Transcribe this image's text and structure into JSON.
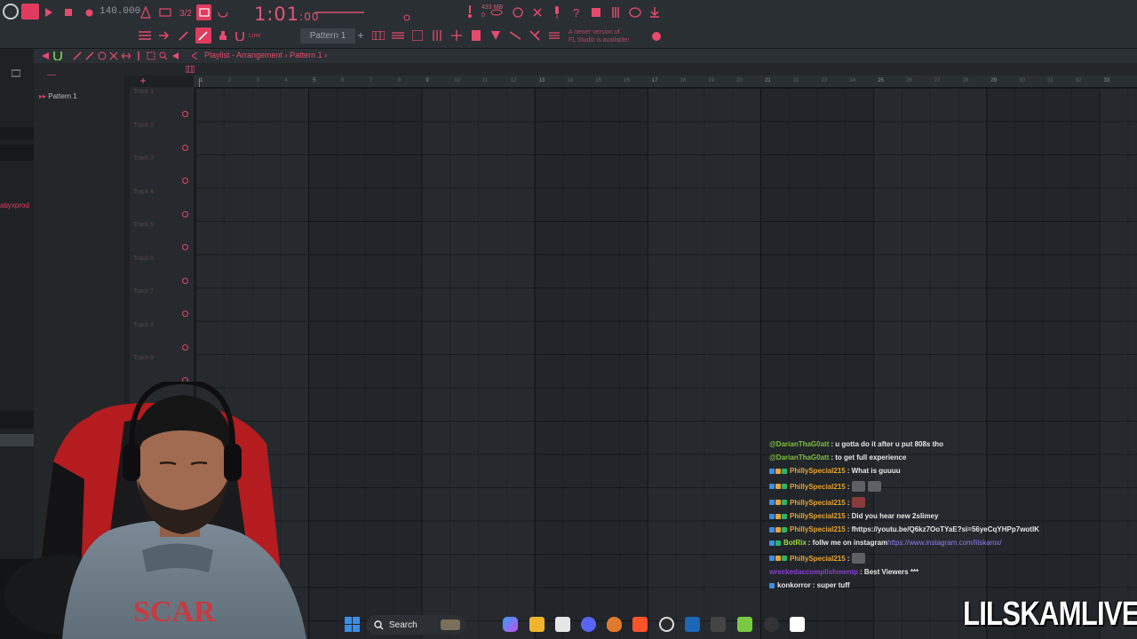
{
  "toolbar": {
    "bpm": "140.000",
    "song_time": "1:01",
    "song_time_ticks": ":00",
    "memory": "433 MB",
    "memory_sub": "0",
    "pattern": "Pattern 1",
    "snap": "Line",
    "update_notice_line1": "A newer version of",
    "update_notice_line2": "FL Studio is available!"
  },
  "playlist": {
    "title": "Playlist - Arrangement",
    "separator": "›",
    "pattern_crumb": "Pattern 1",
    "picker_item": "Pattern 1",
    "tracks": [
      "Track 1",
      "Track 2",
      "Track 3",
      "Track 4",
      "Track 5",
      "Track 6",
      "Track 7",
      "Track 8",
      "Track 9"
    ],
    "bar_numbers": [
      "1",
      "2",
      "3",
      "4",
      "5",
      "6",
      "7",
      "8",
      "9",
      "10",
      "11",
      "12",
      "13",
      "14",
      "15",
      "16",
      "17",
      "18",
      "19",
      "20",
      "21",
      "22",
      "23",
      "24",
      "25",
      "26",
      "27",
      "28",
      "29",
      "30",
      "31",
      "32",
      "33"
    ]
  },
  "browser": {
    "user_label": "abyxprod"
  },
  "chat": {
    "messages": [
      {
        "user": "@DarianThaG0att",
        "text": ": u gotta do it after u put 808s tho",
        "color": "#7fbf3a"
      },
      {
        "user": "@DarianThaG0att",
        "text": ": to get full experience",
        "color": "#7fbf3a"
      },
      {
        "user": "PhillySpecial215",
        "text": ": What is guuuu",
        "color": "#e6a536"
      },
      {
        "user": "PhillySpecial215",
        "text": ":",
        "color": "#e6a536"
      },
      {
        "user": "PhillySpecial215",
        "text": ":",
        "color": "#e6a536"
      },
      {
        "user": "PhillySpecial215",
        "text": ": Did you hear new 2slimey",
        "color": "#e6a536"
      },
      {
        "user": "PhillySpecial215",
        "text": ": fhttps://youtu.be/Q6kz7OoTYaE?si=56yeCqYHPp7wotIK",
        "color": "#e6a536"
      },
      {
        "user": "BotRix",
        "text": ": follw me on instagram ",
        "link": "https://www.instagram.com/lilskamx/",
        "color": "#9de03a"
      },
      {
        "user": "PhillySpecial215",
        "text": ":",
        "color": "#e6a536"
      },
      {
        "user": "wreckedaccomplishmentp",
        "text": ": Best Viewers ***",
        "color": "#8a3fd0"
      },
      {
        "user": "konkorror",
        "text": ": super tuff",
        "color": "#e8e8e8"
      }
    ]
  },
  "taskbar": {
    "search_label": "Search"
  },
  "watermark": "LILSKAMLIVE",
  "colors": {
    "accent": "#e64b6e",
    "background": "#1d2124"
  }
}
